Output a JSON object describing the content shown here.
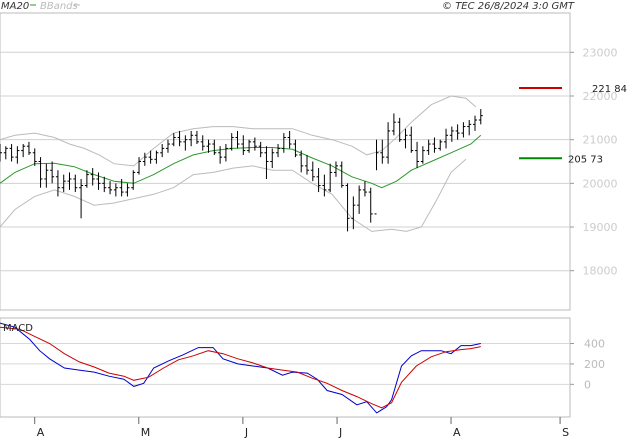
{
  "chart_data": [
    {
      "type": "ohlc",
      "panel": "price",
      "legend": [
        {
          "name": "MA20",
          "color": "#2a9a2a"
        },
        {
          "name": "BBands",
          "color": "#bbbbbb"
        }
      ],
      "source": "© TEC 26/8/2024 3:0 GMT",
      "ylim": [
        17100,
        23900
      ],
      "yticks": [
        18000,
        19000,
        20000,
        21000,
        22000,
        23000
      ],
      "ytick_labels": [
        "18000",
        "19000",
        "20000",
        "21000",
        "22000",
        "23000"
      ],
      "x_months": [
        {
          "label": "A",
          "day": 0
        },
        {
          "label": "M",
          "day": 21
        },
        {
          "label": "J",
          "day": 42
        },
        {
          "label": "J",
          "day": 61
        },
        {
          "label": "A",
          "day": 84
        },
        {
          "label": "S",
          "day": 106
        }
      ],
      "x_range_days": [
        -7,
        108
      ],
      "annotations": [
        {
          "value": 22184,
          "label": "221 84",
          "color": "#cc0000",
          "side": "resistance"
        },
        {
          "value": 20573,
          "label": "205 73",
          "color": "#008800",
          "side": "support"
        }
      ],
      "ohlc": [
        [
          20750,
          20900,
          20500,
          20700
        ],
        [
          20700,
          20850,
          20550,
          20800
        ],
        [
          20800,
          20900,
          20500,
          20600
        ],
        [
          20600,
          20850,
          20450,
          20750
        ],
        [
          20750,
          20900,
          20600,
          20850
        ],
        [
          20850,
          20950,
          20650,
          20700
        ],
        [
          20700,
          20800,
          20400,
          20500
        ],
        [
          20500,
          20600,
          19900,
          20100
        ],
        [
          20100,
          20450,
          19900,
          20300
        ],
        [
          20300,
          20500,
          20000,
          20150
        ],
        [
          20150,
          20300,
          19700,
          19900
        ],
        [
          19900,
          20200,
          19800,
          20050
        ],
        [
          20050,
          20250,
          19850,
          20100
        ],
        [
          20100,
          20200,
          19800,
          19900
        ],
        [
          19900,
          20100,
          19200,
          19950
        ],
        [
          19950,
          20300,
          19900,
          20200
        ],
        [
          20200,
          20350,
          19950,
          20100
        ],
        [
          20100,
          20250,
          19850,
          20000
        ],
        [
          20000,
          20150,
          19800,
          19900
        ],
        [
          19900,
          20050,
          19750,
          19850
        ],
        [
          19850,
          20000,
          19700,
          19900
        ],
        [
          19900,
          20100,
          19700,
          19800
        ],
        [
          19800,
          20000,
          19700,
          19900
        ],
        [
          19900,
          20300,
          19850,
          20250
        ],
        [
          20250,
          20600,
          20200,
          20500
        ],
        [
          20500,
          20700,
          20400,
          20600
        ],
        [
          20600,
          20750,
          20450,
          20550
        ],
        [
          20550,
          20750,
          20450,
          20700
        ],
        [
          20700,
          20900,
          20600,
          20800
        ],
        [
          20800,
          21000,
          20700,
          20900
        ],
        [
          20900,
          21150,
          20850,
          21050
        ],
        [
          21050,
          21200,
          20850,
          20950
        ],
        [
          20950,
          21100,
          20750,
          21000
        ],
        [
          21000,
          21200,
          20850,
          21100
        ],
        [
          21100,
          21200,
          20900,
          20950
        ],
        [
          20950,
          21100,
          20750,
          20850
        ],
        [
          20850,
          21000,
          20700,
          20900
        ],
        [
          20900,
          21000,
          20650,
          20700
        ],
        [
          20700,
          20850,
          20450,
          20600
        ],
        [
          20600,
          20900,
          20500,
          20800
        ],
        [
          20800,
          21150,
          20750,
          21050
        ],
        [
          21050,
          21200,
          20800,
          20900
        ],
        [
          20900,
          21100,
          20650,
          20750
        ],
        [
          20750,
          21000,
          20700,
          20950
        ],
        [
          20950,
          21050,
          20750,
          20850
        ],
        [
          20850,
          20950,
          20600,
          20700
        ],
        [
          20700,
          20850,
          20100,
          20500
        ],
        [
          20500,
          20800,
          20350,
          20700
        ],
        [
          20700,
          20900,
          20600,
          20800
        ],
        [
          20800,
          21150,
          20700,
          21050
        ],
        [
          21050,
          21200,
          20800,
          20900
        ],
        [
          20900,
          21000,
          20600,
          20650
        ],
        [
          20650,
          20750,
          20250,
          20400
        ],
        [
          20400,
          20650,
          20200,
          20300
        ],
        [
          20300,
          20500,
          20050,
          20150
        ],
        [
          20150,
          20350,
          19800,
          19950
        ],
        [
          19950,
          20200,
          19700,
          19850
        ],
        [
          19850,
          20450,
          19800,
          20250
        ],
        [
          20250,
          20500,
          20150,
          20400
        ],
        [
          20400,
          20500,
          19900,
          19950
        ],
        [
          19950,
          20000,
          18900,
          19200
        ],
        [
          19200,
          19700,
          18950,
          19500
        ],
        [
          19500,
          19950,
          19300,
          19850
        ],
        [
          19850,
          20050,
          19700,
          19800
        ],
        [
          19800,
          19900,
          19100,
          19300
        ],
        [
          19300,
          21000,
          20300,
          20700
        ],
        [
          20700,
          21000,
          20450,
          20600
        ],
        [
          20600,
          21400,
          20450,
          21200
        ],
        [
          21200,
          21600,
          21100,
          21400
        ],
        [
          21400,
          21500,
          20950,
          21000
        ],
        [
          21000,
          21250,
          20800,
          21100
        ],
        [
          21100,
          21300,
          20700,
          20750
        ],
        [
          20750,
          20950,
          20350,
          20500
        ],
        [
          20500,
          20850,
          20450,
          20750
        ],
        [
          20750,
          21000,
          20650,
          20900
        ],
        [
          20900,
          21050,
          20700,
          20800
        ],
        [
          20800,
          21000,
          20750,
          20950
        ],
        [
          20950,
          21250,
          20800,
          21100
        ],
        [
          21100,
          21300,
          20950,
          21200
        ],
        [
          21200,
          21350,
          21000,
          21150
        ],
        [
          21150,
          21400,
          21050,
          21300
        ],
        [
          21300,
          21450,
          21100,
          21350
        ],
        [
          21350,
          21550,
          21200,
          21450
        ],
        [
          21450,
          21700,
          21350,
          21550
        ]
      ],
      "ma20": [
        [
          -7,
          20000
        ],
        [
          -4,
          20250
        ],
        [
          0,
          20450
        ],
        [
          4,
          20460
        ],
        [
          8,
          20380
        ],
        [
          12,
          20200
        ],
        [
          16,
          20050
        ],
        [
          20,
          20000
        ],
        [
          24,
          20200
        ],
        [
          28,
          20450
        ],
        [
          32,
          20650
        ],
        [
          36,
          20750
        ],
        [
          40,
          20800
        ],
        [
          44,
          20820
        ],
        [
          48,
          20820
        ],
        [
          52,
          20780
        ],
        [
          56,
          20580
        ],
        [
          60,
          20400
        ],
        [
          64,
          20150
        ],
        [
          68,
          20000
        ],
        [
          70,
          19900
        ],
        [
          73,
          20050
        ],
        [
          76,
          20300
        ],
        [
          80,
          20500
        ],
        [
          84,
          20700
        ],
        [
          88,
          20900
        ],
        [
          90,
          21100
        ]
      ],
      "bb_upper": [
        [
          -7,
          21000
        ],
        [
          -4,
          21100
        ],
        [
          0,
          21150
        ],
        [
          4,
          21050
        ],
        [
          7,
          20900
        ],
        [
          10,
          20800
        ],
        [
          13,
          20650
        ],
        [
          16,
          20450
        ],
        [
          20,
          20400
        ],
        [
          24,
          20800
        ],
        [
          28,
          21150
        ],
        [
          32,
          21250
        ],
        [
          36,
          21300
        ],
        [
          40,
          21300
        ],
        [
          44,
          21250
        ],
        [
          48,
          21250
        ],
        [
          52,
          21250
        ],
        [
          56,
          21100
        ],
        [
          60,
          21000
        ],
        [
          64,
          20850
        ],
        [
          67,
          20650
        ],
        [
          70,
          20750
        ],
        [
          73,
          21050
        ],
        [
          76,
          21400
        ],
        [
          80,
          21800
        ],
        [
          84,
          22000
        ],
        [
          87,
          21950
        ],
        [
          89,
          21750
        ]
      ],
      "bb_lower": [
        [
          -7,
          19000
        ],
        [
          -4,
          19400
        ],
        [
          0,
          19700
        ],
        [
          4,
          19850
        ],
        [
          8,
          19700
        ],
        [
          12,
          19500
        ],
        [
          16,
          19550
        ],
        [
          20,
          19650
        ],
        [
          24,
          19750
        ],
        [
          28,
          19900
        ],
        [
          32,
          20200
        ],
        [
          36,
          20250
        ],
        [
          40,
          20350
        ],
        [
          44,
          20400
        ],
        [
          48,
          20300
        ],
        [
          52,
          20300
        ],
        [
          56,
          20000
        ],
        [
          60,
          19750
        ],
        [
          64,
          19200
        ],
        [
          68,
          18900
        ],
        [
          72,
          18950
        ],
        [
          75,
          18900
        ],
        [
          78,
          19000
        ],
        [
          81,
          19600
        ],
        [
          84,
          20250
        ],
        [
          87,
          20550
        ]
      ]
    },
    {
      "type": "line",
      "panel": "macd",
      "title": "MACD",
      "ylim": [
        -320,
        650
      ],
      "yticks": [
        0,
        200,
        400
      ],
      "ytick_labels": [
        "0",
        "200",
        "400"
      ],
      "series": [
        {
          "color": "#0000cc",
          "points": [
            [
              -7,
              600
            ],
            [
              -4,
              560
            ],
            [
              -1,
              440
            ],
            [
              1,
              330
            ],
            [
              3,
              250
            ],
            [
              6,
              160
            ],
            [
              9,
              140
            ],
            [
              12,
              120
            ],
            [
              15,
              80
            ],
            [
              18,
              50
            ],
            [
              20,
              -20
            ],
            [
              22,
              10
            ],
            [
              24,
              160
            ],
            [
              27,
              230
            ],
            [
              30,
              290
            ],
            [
              33,
              360
            ],
            [
              36,
              360
            ],
            [
              38,
              250
            ],
            [
              41,
              200
            ],
            [
              44,
              180
            ],
            [
              47,
              160
            ],
            [
              50,
              90
            ],
            [
              52,
              120
            ],
            [
              55,
              110
            ],
            [
              57,
              50
            ],
            [
              59,
              -60
            ],
            [
              62,
              -100
            ],
            [
              65,
              -200
            ],
            [
              67,
              -170
            ],
            [
              69,
              -280
            ],
            [
              71,
              -220
            ],
            [
              72,
              -150
            ],
            [
              74,
              180
            ],
            [
              76,
              280
            ],
            [
              78,
              330
            ],
            [
              80,
              330
            ],
            [
              82,
              330
            ],
            [
              84,
              300
            ],
            [
              86,
              380
            ],
            [
              88,
              380
            ],
            [
              90,
              400
            ]
          ]
        },
        {
          "color": "#cc0000",
          "points": [
            [
              -7,
              560
            ],
            [
              -3,
              540
            ],
            [
              0,
              470
            ],
            [
              3,
              400
            ],
            [
              6,
              300
            ],
            [
              9,
              220
            ],
            [
              12,
              170
            ],
            [
              15,
              110
            ],
            [
              18,
              80
            ],
            [
              20,
              40
            ],
            [
              23,
              70
            ],
            [
              26,
              160
            ],
            [
              29,
              240
            ],
            [
              32,
              280
            ],
            [
              35,
              330
            ],
            [
              38,
              300
            ],
            [
              41,
              250
            ],
            [
              44,
              210
            ],
            [
              47,
              160
            ],
            [
              50,
              140
            ],
            [
              53,
              120
            ],
            [
              56,
              60
            ],
            [
              59,
              10
            ],
            [
              62,
              -60
            ],
            [
              65,
              -120
            ],
            [
              68,
              -190
            ],
            [
              70,
              -230
            ],
            [
              72,
              -180
            ],
            [
              74,
              20
            ],
            [
              77,
              180
            ],
            [
              80,
              270
            ],
            [
              83,
              320
            ],
            [
              86,
              340
            ],
            [
              88,
              350
            ],
            [
              90,
              370
            ]
          ]
        }
      ]
    }
  ]
}
